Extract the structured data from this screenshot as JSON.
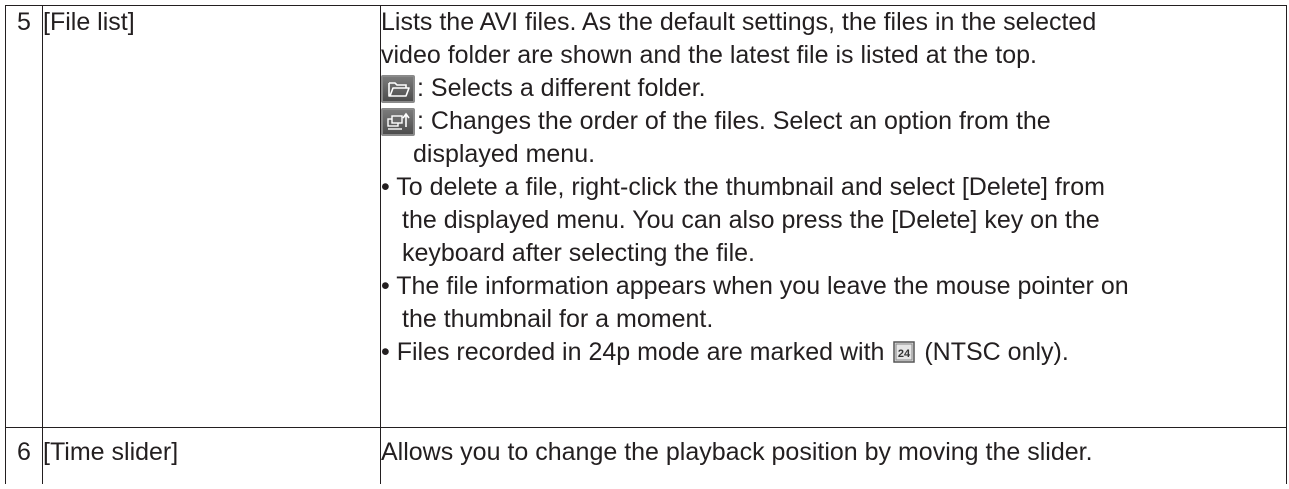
{
  "rows": [
    {
      "num": "5",
      "name": "[File list]",
      "desc": {
        "intro_line1": "Lists the AVI files. As the default settings, the files in the selected",
        "intro_line2": "video folder are shown and the latest file is listed at the top.",
        "folder_button": {
          "icon": "folder-open-icon",
          "text": ": Selects a different folder."
        },
        "sort_button": {
          "icon": "sort-order-icon",
          "text_line1": ": Changes the order of the files. Select an option from the",
          "text_line2": "displayed menu."
        },
        "bullet_delete": {
          "line1": "• To delete a file, right-click the thumbnail and select [Delete] from",
          "line2": "the displayed menu. You can also press the [Delete] key on the",
          "line3": "keyboard after selecting the file."
        },
        "bullet_info": {
          "line1": "• The file information appears when you leave the mouse pointer on",
          "line2": "the thumbnail for a moment."
        },
        "bullet_24p": {
          "before": "• Files recorded in 24p mode are marked with",
          "icon": "24p-mark-icon",
          "after": "(NTSC only)."
        }
      }
    },
    {
      "num": "6",
      "name": "[Time slider]",
      "desc": {
        "text": "Allows you to change the playback position by moving the slider."
      }
    }
  ],
  "colors": {
    "text": "#231f20",
    "border": "#231f20",
    "button_icon": "#5f5f5f"
  }
}
